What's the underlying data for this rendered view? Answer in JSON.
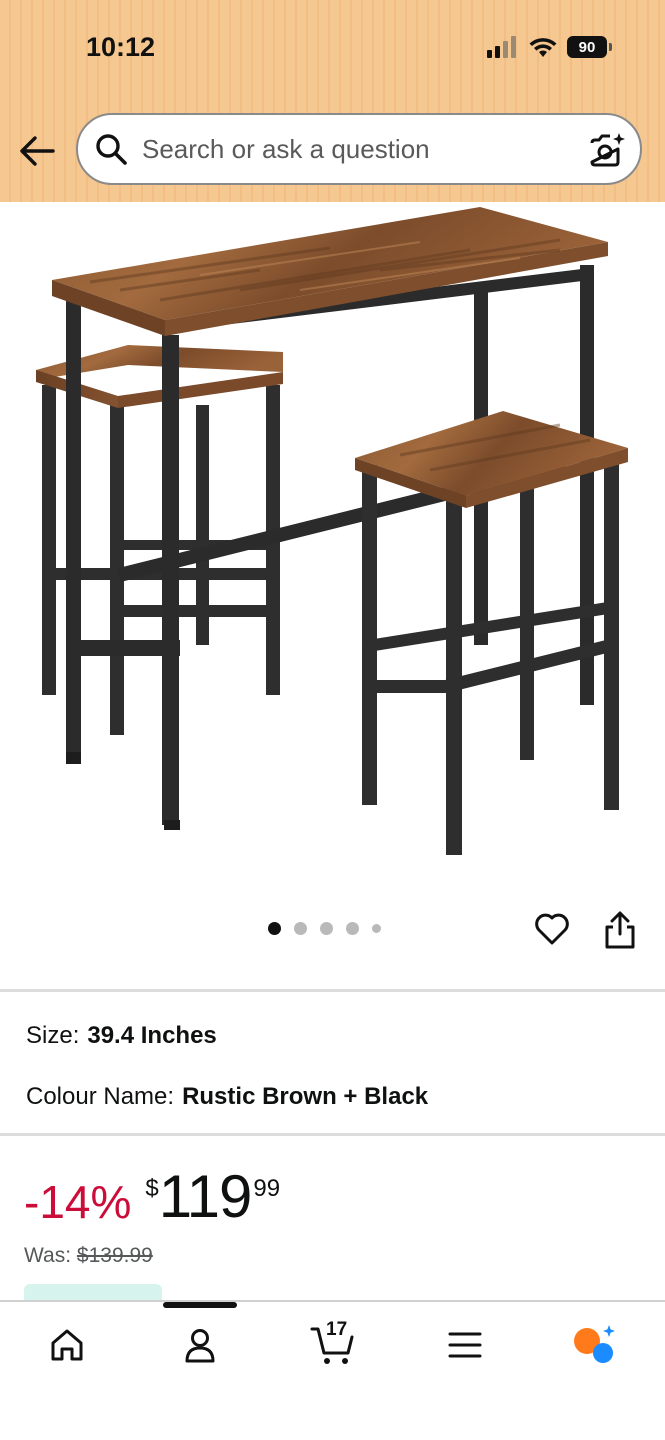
{
  "status_bar": {
    "time": "10:12",
    "battery": "90"
  },
  "search": {
    "placeholder": "Search or ask a question"
  },
  "gallery": {
    "image_count": 5,
    "active_index": 0
  },
  "variations": {
    "size_label": "Size:",
    "size_value": "39.4 Inches",
    "colour_label": "Colour Name:",
    "colour_value": "Rustic Brown + Black"
  },
  "price": {
    "discount": "-14%",
    "currency": "$",
    "whole": "119",
    "fraction": "99",
    "was_label": "Was:",
    "was_value": "$139.99"
  },
  "nav": {
    "cart_count": "17"
  },
  "colors": {
    "header_bg": "#f6c891",
    "discount_red": "#cc0c39",
    "assistant_orange": "#ff7a1a",
    "assistant_blue": "#1a8cff"
  },
  "icons": [
    "back-arrow-icon",
    "search-icon",
    "camera-icon",
    "heart-icon",
    "share-icon",
    "home-icon",
    "account-icon",
    "cart-icon",
    "menu-icon",
    "assistant-icon"
  ]
}
